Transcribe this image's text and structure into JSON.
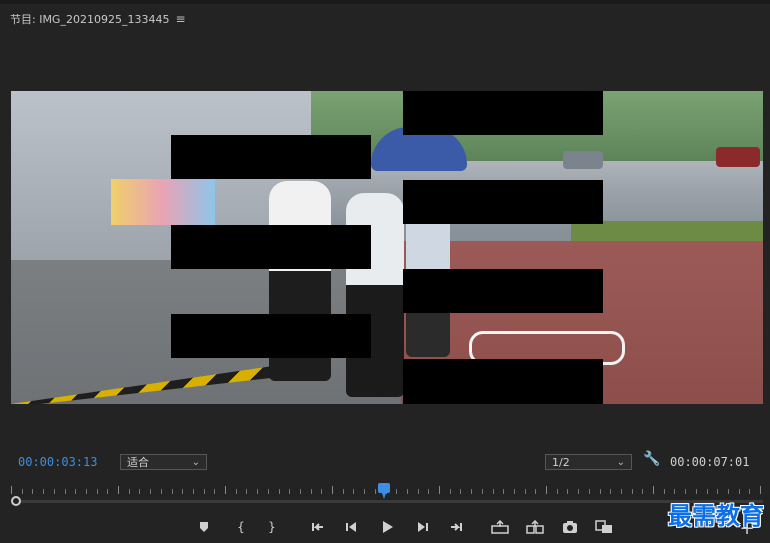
{
  "panel": {
    "title": "节目: IMG_20210925_133445",
    "menu_icon": "hamburger-icon"
  },
  "controls": {
    "current_timecode": "00:00:03:13",
    "fit": {
      "selected": "适合"
    },
    "resolution": {
      "selected": "1/2"
    },
    "settings_icon": "wrench-icon",
    "duration_timecode": "00:00:07:01"
  },
  "transport": [
    {
      "name": "add-marker-icon"
    },
    {
      "name": "mark-in-icon"
    },
    {
      "name": "mark-out-icon"
    },
    {
      "name": "go-to-in-icon"
    },
    {
      "name": "step-back-icon"
    },
    {
      "name": "play-icon"
    },
    {
      "name": "step-forward-icon"
    },
    {
      "name": "go-to-out-icon"
    },
    {
      "name": "lift-icon"
    },
    {
      "name": "extract-icon"
    },
    {
      "name": "export-frame-icon"
    },
    {
      "name": "comparison-view-icon"
    }
  ],
  "watermark": {
    "text": "最需教育"
  },
  "colors": {
    "accent": "#3d8ee0",
    "background": "#232323",
    "mask": "#000000"
  }
}
